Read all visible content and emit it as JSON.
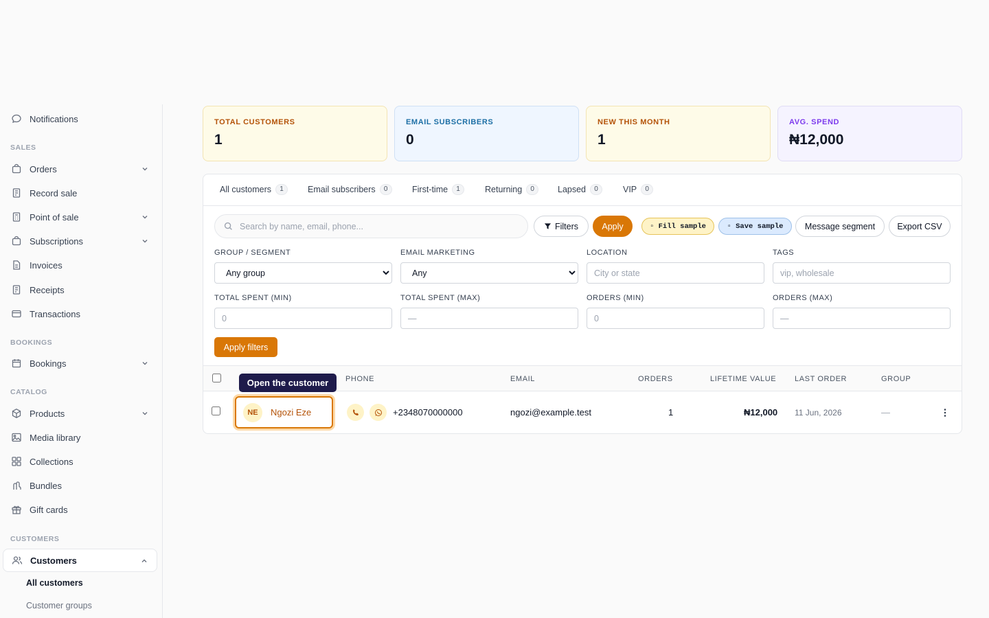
{
  "sidebar": {
    "notifications": "Notifications",
    "sections": {
      "sales": "SALES",
      "bookings": "BOOKINGS",
      "catalog": "CATALOG",
      "customers": "CUSTOMERS"
    },
    "items": {
      "orders": "Orders",
      "record_sale": "Record sale",
      "point_of_sale": "Point of sale",
      "subscriptions": "Subscriptions",
      "invoices": "Invoices",
      "receipts": "Receipts",
      "transactions": "Transactions",
      "bookings": "Bookings",
      "products": "Products",
      "media_library": "Media library",
      "collections": "Collections",
      "bundles": "Bundles",
      "gift_cards": "Gift cards",
      "customers": "Customers"
    },
    "sub": {
      "all_customers": "All customers",
      "customer_groups": "Customer groups"
    }
  },
  "stats": [
    {
      "label": "TOTAL CUSTOMERS",
      "value": "1"
    },
    {
      "label": "EMAIL SUBSCRIBERS",
      "value": "0"
    },
    {
      "label": "NEW THIS MONTH",
      "value": "1"
    },
    {
      "label": "AVG. SPEND",
      "value": "₦12,000"
    }
  ],
  "tabs": [
    {
      "label": "All customers",
      "count": "1"
    },
    {
      "label": "Email subscribers",
      "count": "0"
    },
    {
      "label": "First-time",
      "count": "1"
    },
    {
      "label": "Returning",
      "count": "0"
    },
    {
      "label": "Lapsed",
      "count": "0"
    },
    {
      "label": "VIP",
      "count": "0"
    }
  ],
  "toolbar": {
    "search_placeholder": "Search by name, email, phone...",
    "filters": "Filters",
    "apply": "Apply",
    "fill_sample": "▫ Fill sample",
    "save_sample": "▫ Save sample",
    "message_segment": "Message segment",
    "export_csv": "Export CSV"
  },
  "filters": {
    "group_label": "GROUP / SEGMENT",
    "group_value": "Any group",
    "email_label": "EMAIL MARKETING",
    "email_value": "Any",
    "location_label": "LOCATION",
    "location_placeholder": "City or state",
    "tags_label": "TAGS",
    "tags_placeholder": "vip, wholesale",
    "spent_min_label": "TOTAL SPENT (MIN)",
    "spent_min_placeholder": "0",
    "spent_max_label": "TOTAL SPENT (MAX)",
    "spent_max_placeholder": "—",
    "orders_min_label": "ORDERS (MIN)",
    "orders_min_placeholder": "0",
    "orders_max_label": "ORDERS (MAX)",
    "orders_max_placeholder": "—",
    "apply_filters": "Apply filters"
  },
  "table": {
    "headers": {
      "phone": "PHONE",
      "email": "EMAIL",
      "orders": "ORDERS",
      "lifetime_value": "LIFETIME VALUE",
      "last_order": "LAST ORDER",
      "group": "GROUP"
    },
    "rows": [
      {
        "initials": "NE",
        "name": "Ngozi Eze",
        "phone": "+2348070000000",
        "email": "ngozi@example.test",
        "orders": "1",
        "lifetime_value": "₦12,000",
        "last_order": "11 Jun, 2026",
        "group": "—"
      }
    ]
  },
  "tooltip": "Open the customer",
  "colors": {
    "accent": "#d97706",
    "tooltip_bg": "#1e1b4b"
  }
}
